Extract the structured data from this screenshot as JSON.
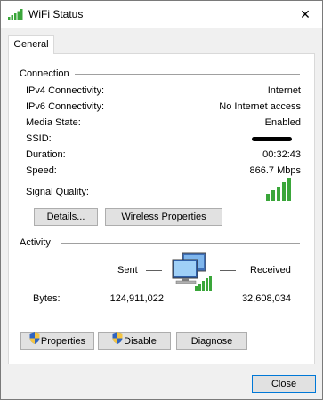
{
  "window": {
    "title": "WiFi Status",
    "close_glyph": "✕"
  },
  "tabs": [
    {
      "label": "General",
      "selected": true
    }
  ],
  "connection": {
    "group_title": "Connection",
    "rows": [
      {
        "label": "IPv4 Connectivity:",
        "value": "Internet"
      },
      {
        "label": "IPv6 Connectivity:",
        "value": "No Internet access"
      },
      {
        "label": "Media State:",
        "value": "Enabled"
      },
      {
        "label": "SSID:",
        "value": ""
      },
      {
        "label": "Duration:",
        "value": "00:32:43"
      },
      {
        "label": "Speed:",
        "value": "866.7 Mbps"
      }
    ],
    "signal_quality_label": "Signal Quality:",
    "signal_bars": 5,
    "details_button": "Details...",
    "wireless_properties_button": "Wireless Properties"
  },
  "activity": {
    "group_title": "Activity",
    "sent_label": "Sent",
    "received_label": "Received",
    "bytes_label": "Bytes:",
    "bytes_sent": "124,911,022",
    "bytes_received": "32,608,034"
  },
  "buttons": {
    "properties": "Properties",
    "disable": "Disable",
    "diagnose": "Diagnose",
    "close": "Close"
  },
  "icons": {
    "title": "wifi-signal-icon",
    "signal": "signal-bars-icon",
    "network": "network-computer-icon",
    "shield": "uac-shield-icon"
  },
  "colors": {
    "signal_green": "#3aa63a",
    "window_bg": "#f0f0f0",
    "panel_bg": "#ffffff",
    "button_bg": "#e1e1e1",
    "button_border": "#adadad"
  }
}
